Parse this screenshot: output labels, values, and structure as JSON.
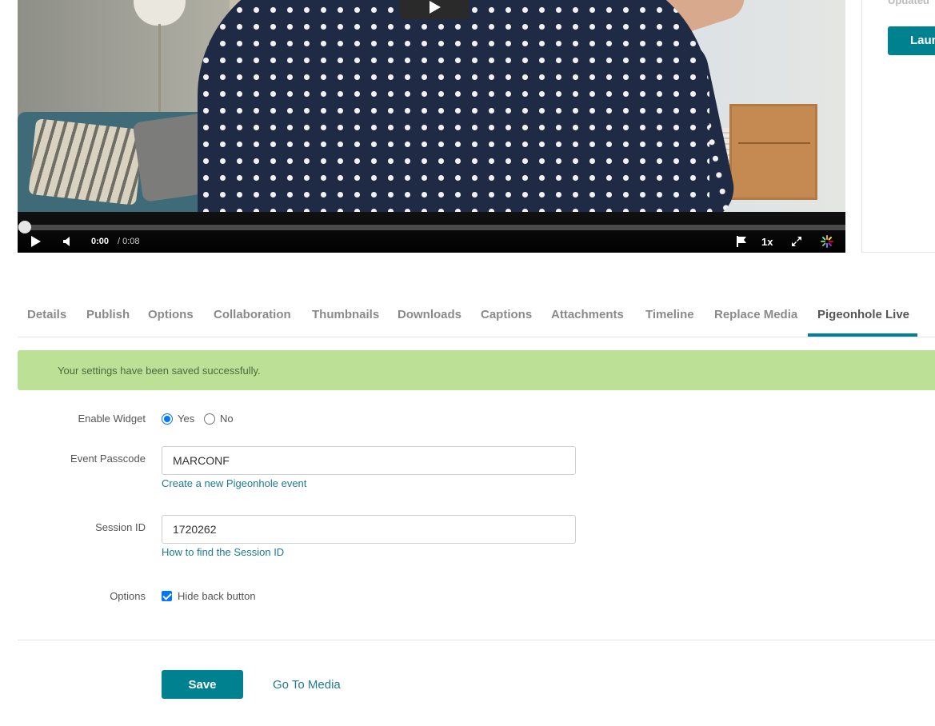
{
  "player": {
    "current_time": "0:00",
    "duration": "/ 0:08",
    "speed": "1x",
    "progress": 0.0
  },
  "side_panel": {
    "updated_label": "Updated",
    "launch_label": "Laun"
  },
  "tabs": [
    {
      "label": "Details",
      "active": false
    },
    {
      "label": "Publish",
      "active": false
    },
    {
      "label": "Options",
      "active": false
    },
    {
      "label": "Collaboration",
      "active": false
    },
    {
      "label": "Thumbnails",
      "active": false
    },
    {
      "label": "Downloads",
      "active": false
    },
    {
      "label": "Captions",
      "active": false
    },
    {
      "label": "Attachments",
      "active": false
    },
    {
      "label": "Timeline",
      "active": false
    },
    {
      "label": "Replace Media",
      "active": false
    },
    {
      "label": "Pigeonhole Live",
      "active": true
    }
  ],
  "banner": {
    "message": "Your settings have been saved successfully."
  },
  "form": {
    "enable_widget": {
      "label": "Enable Widget",
      "yes_label": "Yes",
      "no_label": "No",
      "selected": "Yes"
    },
    "event_passcode": {
      "label": "Event Passcode",
      "value": "MARCONF",
      "help_link": "Create a new Pigeonhole event"
    },
    "session_id": {
      "label": "Session ID",
      "value": "1720262",
      "help_link": "How to find the Session ID"
    },
    "options": {
      "label": "Options",
      "hide_back_button_label": "Hide back button",
      "hide_back_button_checked": true
    }
  },
  "actions": {
    "save_label": "Save",
    "go_to_media_label": "Go To Media"
  },
  "colors": {
    "accent": "#00818f",
    "link": "#1f7a93",
    "success_banner": "#bbe096",
    "radio_checkbox": "#0075ff"
  }
}
